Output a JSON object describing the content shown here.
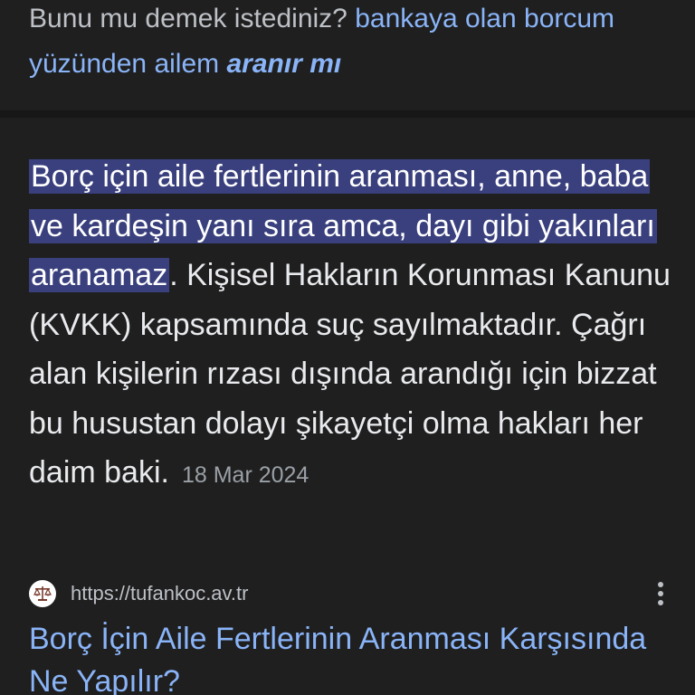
{
  "did_you_mean": {
    "prefix": "Bunu mu demek istediniz?",
    "query_plain": "bankaya olan borcum yüzünden ailem",
    "query_corrected": "aranır mı"
  },
  "snippet": {
    "highlight_lines": [
      "Borç için aile fertlerinin aranması,",
      "anne, baba ve kardeşin yanı sıra amca,",
      "dayı gibi yakınları aranamaz"
    ],
    "rest_text": ". Kişisel Hakların Korunması Kanunu (KVKK) kapsamında suç sayılmaktadır. Çağrı alan kişilerin rızası dışında arandığı için bizzat bu husustan dolayı şikayetçi olma hakları her daim baki.",
    "date": "18 Mar 2024"
  },
  "result": {
    "url": "https://tufankoc.av.tr",
    "favicon_icon": "scales-of-justice-icon",
    "more_icon": "more-vert-icon",
    "title": "Borç İçin Aile Fertlerinin Aranması Karşısında Ne Yapılır?"
  },
  "colors": {
    "background": "#1f1f1f",
    "link": "#8ab4f8",
    "text": "#e8eaed",
    "muted": "#9aa0a6",
    "highlight": "#39407d"
  }
}
